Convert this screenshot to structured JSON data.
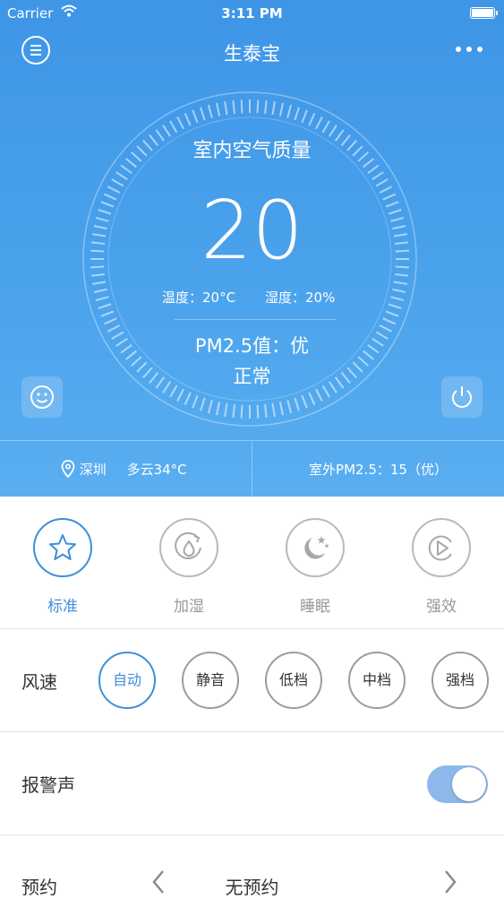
{
  "status_bar": {
    "carrier": "Carrier",
    "time": "3:11 PM"
  },
  "header": {
    "title": "生泰宝",
    "menu_icon": "menu-icon",
    "more_icon": "more-icon"
  },
  "air": {
    "label": "室内空气质量",
    "value": "20",
    "temperature": "温度：20°C",
    "humidity": "湿度：20%",
    "pm25": "PM2.5值：优",
    "status": "正常"
  },
  "weather": {
    "location": "深圳",
    "condition": "多云34°C",
    "outdoor_pm": "室外PM2.5：15（优）"
  },
  "modes": [
    {
      "label": "标准",
      "icon": "star-icon",
      "active": true
    },
    {
      "label": "加湿",
      "icon": "humidify-icon",
      "active": false
    },
    {
      "label": "睡眠",
      "icon": "moon-icon",
      "active": false
    },
    {
      "label": "强效",
      "icon": "boost-icon",
      "active": false
    }
  ],
  "wind": {
    "label": "风速",
    "options": [
      "自动",
      "静音",
      "低档",
      "中档",
      "强档"
    ],
    "selected": "自动"
  },
  "alarm": {
    "label": "报警声",
    "enabled": true
  },
  "schedule": {
    "label": "预约",
    "value": "无预约"
  },
  "colors": {
    "accent": "#3d8fd9",
    "header_blue": "#4aa2ec"
  }
}
